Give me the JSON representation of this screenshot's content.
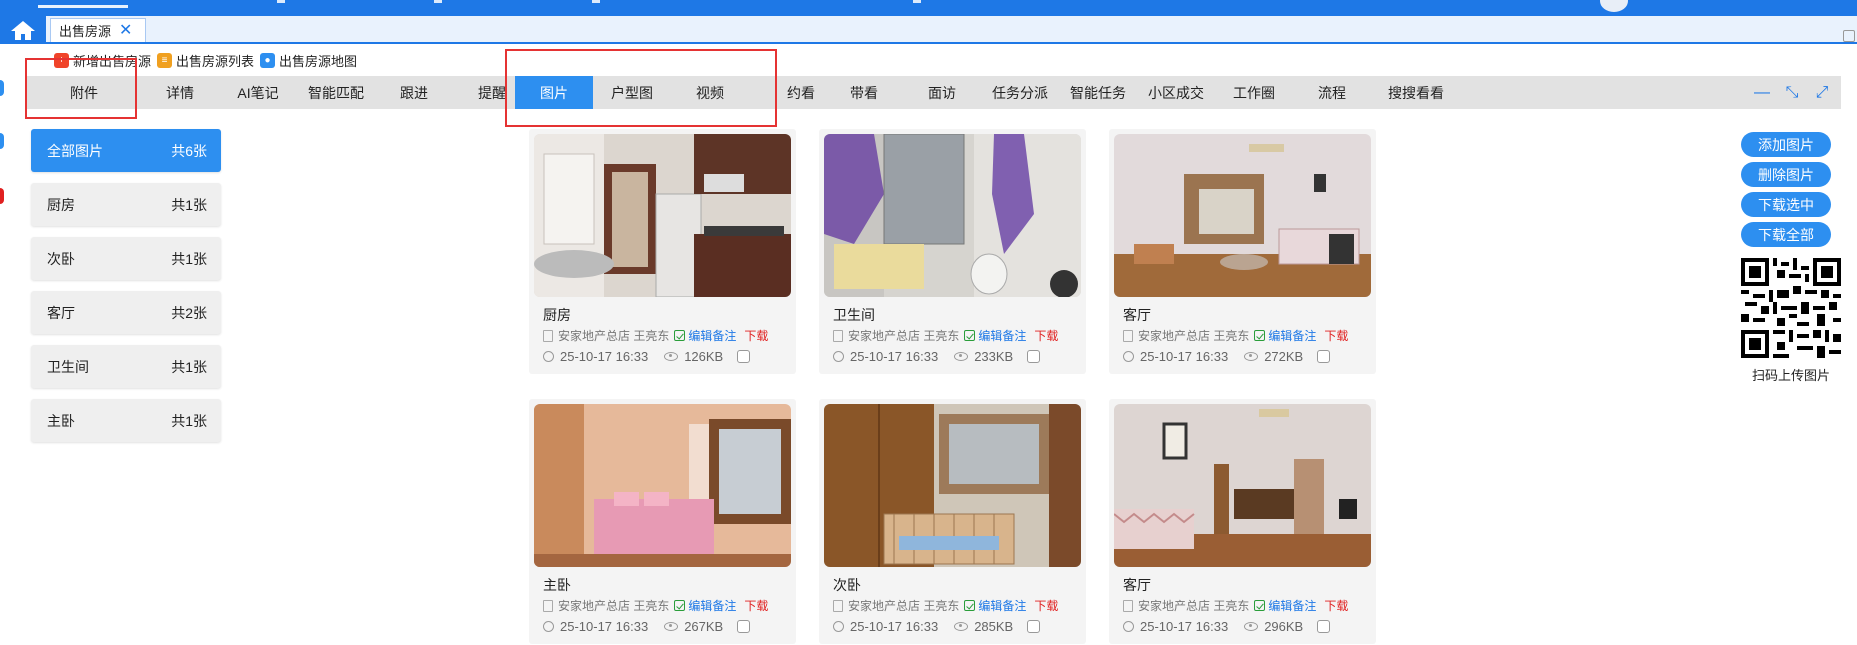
{
  "window": {
    "open_tab_label": "出售房源",
    "open_tab_close": "✕"
  },
  "breadcrumb": {
    "items": [
      {
        "label": "新增出售房源",
        "icon": "add-doc-icon",
        "color": "#f0442a"
      },
      {
        "label": "出售房源列表",
        "icon": "list-icon",
        "color": "#f0a020"
      },
      {
        "label": "出售房源地图",
        "icon": "map-pin-icon",
        "color": "#2d8ff0"
      }
    ]
  },
  "module_tabs": [
    {
      "label": "附件",
      "active": false
    },
    {
      "label": "详情",
      "active": false
    },
    {
      "label": "AI笔记",
      "active": false
    },
    {
      "label": "智能匹配",
      "active": false
    },
    {
      "label": "跟进",
      "active": false
    },
    {
      "label": "提醒",
      "active": false
    },
    {
      "label": "图片",
      "active": true
    },
    {
      "label": "户型图",
      "active": false
    },
    {
      "label": "视频",
      "active": false
    },
    {
      "label": "约看",
      "active": false
    },
    {
      "label": "带看",
      "active": false
    },
    {
      "label": "面访",
      "active": false
    },
    {
      "label": "任务分派",
      "active": false
    },
    {
      "label": "智能任务",
      "active": false
    },
    {
      "label": "小区成交",
      "active": false
    },
    {
      "label": "工作圈",
      "active": false
    },
    {
      "label": "流程",
      "active": false
    },
    {
      "label": "搜搜看看",
      "active": false
    }
  ],
  "window_controls": [
    "minimize-icon",
    "collapse-icon",
    "expand-icon"
  ],
  "categories": [
    {
      "label": "全部图片",
      "count": "共6张",
      "active": true
    },
    {
      "label": "厨房",
      "count": "共1张",
      "active": false
    },
    {
      "label": "次卧",
      "count": "共1张",
      "active": false
    },
    {
      "label": "客厅",
      "count": "共2张",
      "active": false
    },
    {
      "label": "卫生间",
      "count": "共1张",
      "active": false
    },
    {
      "label": "主卧",
      "count": "共1张",
      "active": false
    }
  ],
  "photos": [
    {
      "title": "厨房",
      "agent": "安家地产总店 王亮东",
      "edit": "编辑备注",
      "download": "下载",
      "time": "25-10-17 16:33",
      "size": "126KB",
      "scene": "kitchen"
    },
    {
      "title": "卫生间",
      "agent": "安家地产总店 王亮东",
      "edit": "编辑备注",
      "download": "下载",
      "time": "25-10-17 16:33",
      "size": "233KB",
      "scene": "bathroom"
    },
    {
      "title": "客厅",
      "agent": "安家地产总店 王亮东",
      "edit": "编辑备注",
      "download": "下载",
      "time": "25-10-17 16:33",
      "size": "272KB",
      "scene": "living1"
    },
    {
      "title": "主卧",
      "agent": "安家地产总店 王亮东",
      "edit": "编辑备注",
      "download": "下载",
      "time": "25-10-17 16:33",
      "size": "267KB",
      "scene": "master"
    },
    {
      "title": "次卧",
      "agent": "安家地产总店 王亮东",
      "edit": "编辑备注",
      "download": "下载",
      "time": "25-10-17 16:33",
      "size": "285KB",
      "scene": "second"
    },
    {
      "title": "客厅",
      "agent": "安家地产总店 王亮东",
      "edit": "编辑备注",
      "download": "下载",
      "time": "25-10-17 16:33",
      "size": "296KB",
      "scene": "living2"
    }
  ],
  "actions": {
    "add_photo": "添加图片",
    "delete_photo": "删除图片",
    "download_selected": "下载选中",
    "download_all": "下载全部",
    "qr_label": "扫码上传图片"
  },
  "colors": {
    "accent": "#2d8ff0",
    "topbar": "#1e78e6",
    "highlight": "#e53333",
    "download": "#e02020",
    "edit_green": "#2a9d3a"
  }
}
